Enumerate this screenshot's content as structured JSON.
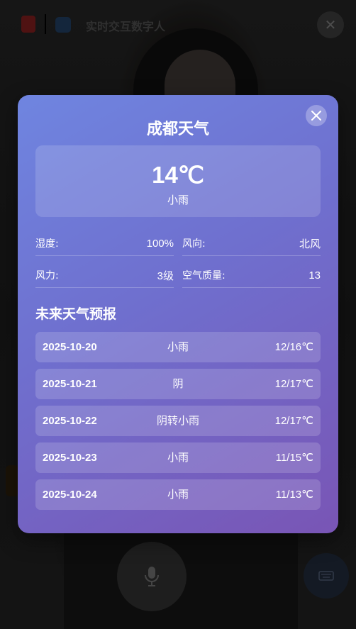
{
  "app": {
    "title": "实时交互数字人",
    "close_icon": "close-icon",
    "mic_icon": "microphone-icon",
    "keyboard_icon": "keyboard-icon"
  },
  "weather_modal": {
    "title": "成都天气",
    "close_icon": "close-icon",
    "current": {
      "temperature": "14℃",
      "condition": "小雨"
    },
    "details": [
      {
        "label": "湿度:",
        "value": "100%"
      },
      {
        "label": "风向:",
        "value": "北风"
      },
      {
        "label": "风力:",
        "value": "3级"
      },
      {
        "label": "空气质量:",
        "value": "13"
      }
    ],
    "forecast_title": "未来天气预报",
    "forecast": [
      {
        "date": "2025-10-20",
        "condition": "小雨",
        "temp": "12/16℃"
      },
      {
        "date": "2025-10-21",
        "condition": "阴",
        "temp": "12/17℃"
      },
      {
        "date": "2025-10-22",
        "condition": "阴转小雨",
        "temp": "12/17℃"
      },
      {
        "date": "2025-10-23",
        "condition": "小雨",
        "temp": "11/15℃"
      },
      {
        "date": "2025-10-24",
        "condition": "小雨",
        "temp": "11/13℃"
      }
    ]
  },
  "colors": {
    "modal_gradient_start": "#6f85e0",
    "modal_gradient_end": "#7955b5",
    "text": "#ffffff"
  }
}
